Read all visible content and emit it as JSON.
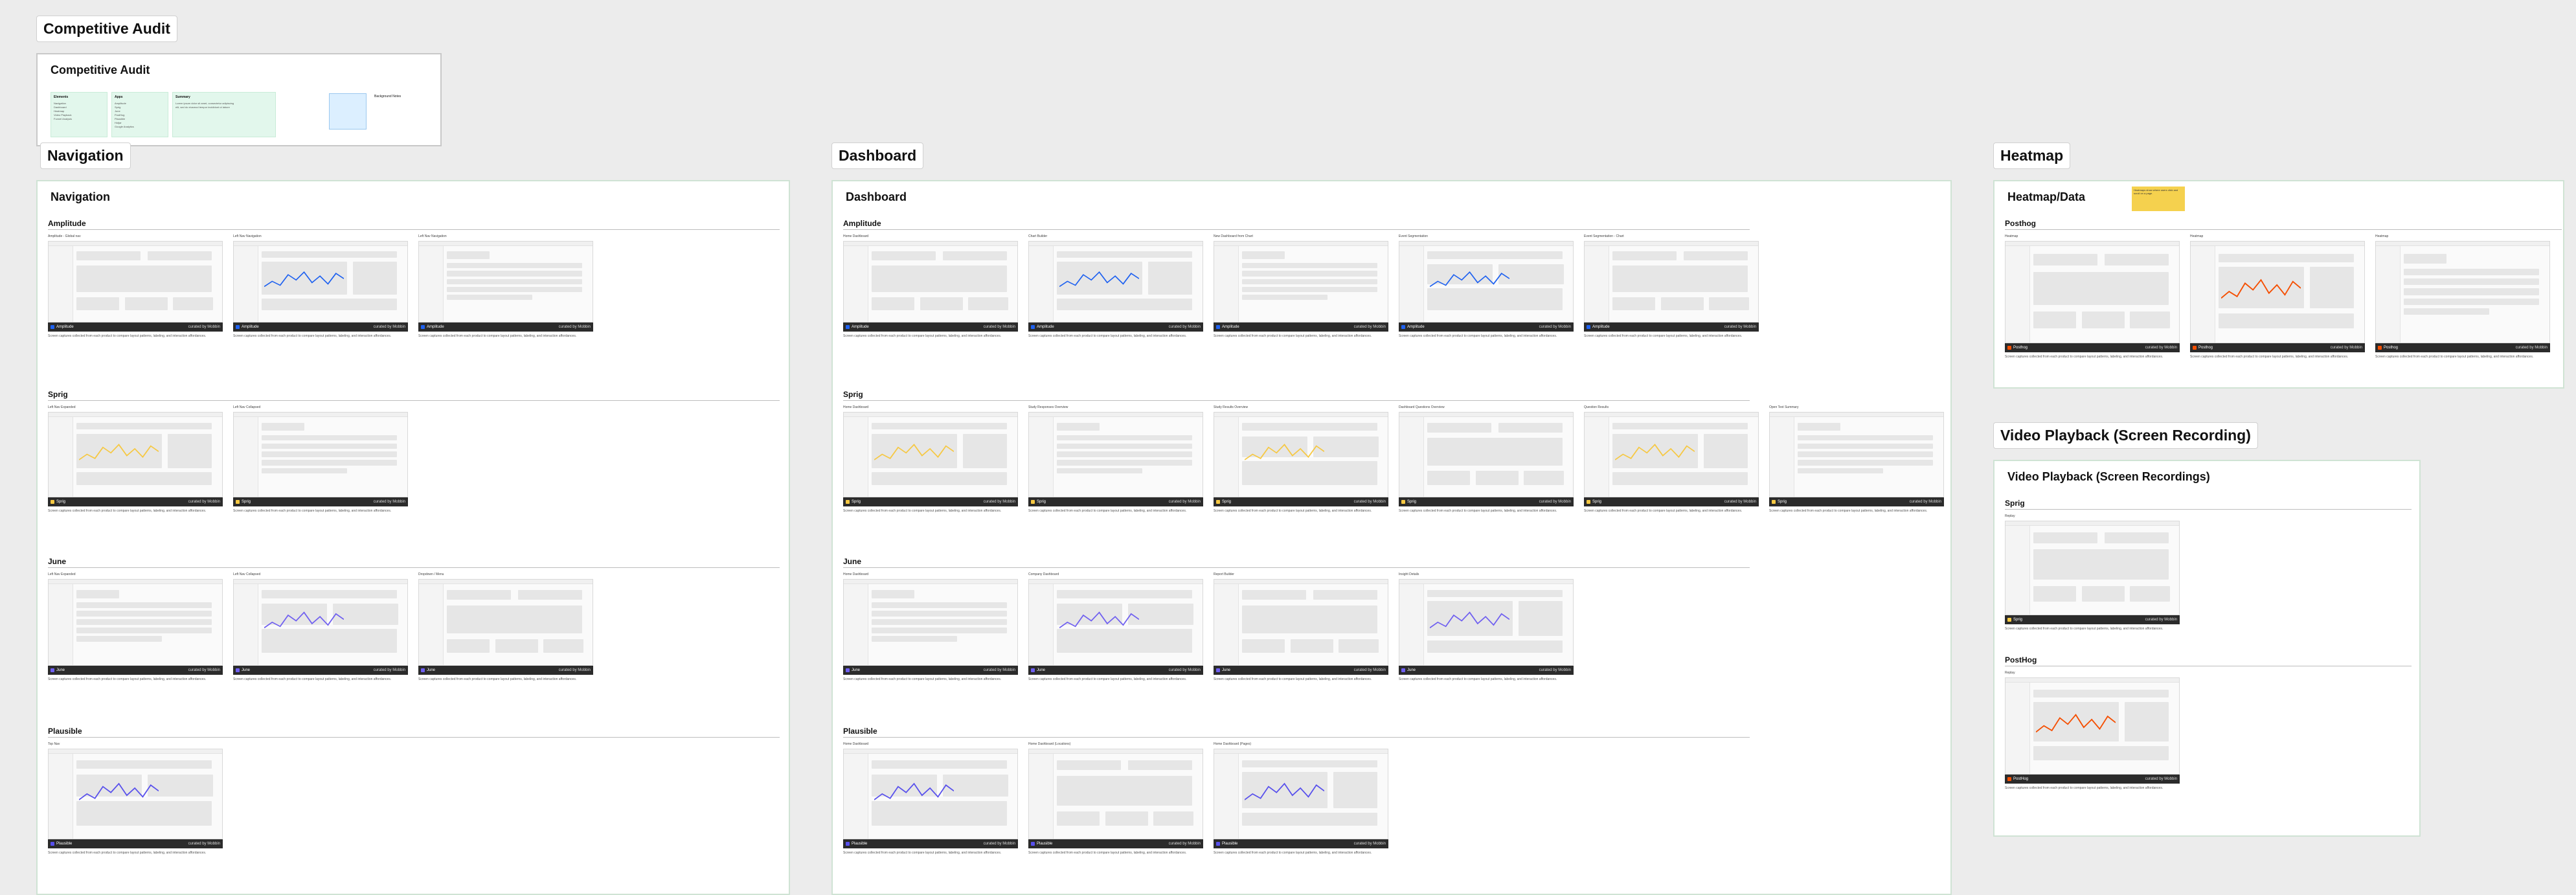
{
  "canvas": {
    "audit": {
      "tag": "Competitive Audit",
      "title": "Competitive Audit",
      "cols": [
        {
          "label": "Elements",
          "items": [
            "Navigation",
            "Dashboard",
            "Heatmap",
            "Video Playback",
            "Funnel Analysis"
          ]
        },
        {
          "label": "Apps",
          "items": [
            "Amplitude",
            "Sprig",
            "June",
            "PostHog",
            "Plausible",
            "Hotjar",
            "Google Analytics"
          ]
        },
        {
          "label": "Summary",
          "items": [
            "Lorem ipsum dolor sit amet, consectetur adipiscing",
            "elit, sed do eiusmod tempor incididunt ut labore"
          ]
        }
      ],
      "note": "Background Notes"
    },
    "navigation": {
      "tag": "Navigation",
      "title": "Navigation",
      "sections": [
        {
          "name": "Amplitude",
          "cards": [
            "Amplitude - Global nav",
            "Left Nav Navigation",
            "Left Nav Navigation"
          ]
        },
        {
          "name": "Sprig",
          "cards": [
            "Left Nav Expanded",
            "Left Nav Collapsed"
          ]
        },
        {
          "name": "June",
          "cards": [
            "Left Nav Expanded",
            "Left Nav Collapsed",
            "Dropdown / Menu"
          ]
        },
        {
          "name": "Plausible",
          "cards": [
            "Top Nav"
          ]
        }
      ]
    },
    "dashboard": {
      "tag": "Dashboard",
      "title": "Dashboard",
      "sections": [
        {
          "name": "Amplitude",
          "cards": [
            "Home Dashboard",
            "Chart Builder",
            "New Dashboard from Chart",
            "Event Segmentation",
            "Event Segmentation - Chart"
          ]
        },
        {
          "name": "Sprig",
          "cards": [
            "Home Dashboard",
            "Study Responses Overview",
            "Study Results Overview",
            "Dashboard Questions Overview",
            "Question Results",
            "Open Text Summary"
          ]
        },
        {
          "name": "June",
          "cards": [
            "Home Dashboard",
            "Company Dashboard",
            "Report Builder",
            "Insight Details"
          ]
        },
        {
          "name": "Plausible",
          "cards": [
            "Home Dashboard",
            "Home Dashboard (Locations)",
            "Home Dashboard (Pages)"
          ]
        }
      ]
    },
    "heatmap": {
      "tag": "Heatmap",
      "title": "Heatmap/Data",
      "sections": [
        {
          "name": "Posthog",
          "cards": [
            "Heatmap",
            "Heatmap",
            "Heatmap"
          ]
        }
      ],
      "sticky": "Heatmaps show where users click and scroll on a page."
    },
    "video": {
      "tag": "Video Playback (Screen Recording)",
      "title": "Video Playback (Screen Recordings)",
      "sections": [
        {
          "name": "Sprig",
          "cards": [
            "Replay"
          ]
        },
        {
          "name": "PostHog",
          "cards": [
            "Replay"
          ]
        }
      ]
    },
    "footer_brand": "curated by Mobbin",
    "brands": {
      "Amplitude": "#1e61f0",
      "Sprig": "#f6c842",
      "June": "#6f5ff0",
      "Plausible": "#5850ec",
      "Posthog": "#f54e00",
      "PostHog": "#f54e00"
    },
    "desc_text": "Screen captures collected from each product to compare layout patterns, labeling, and interaction affordances."
  }
}
